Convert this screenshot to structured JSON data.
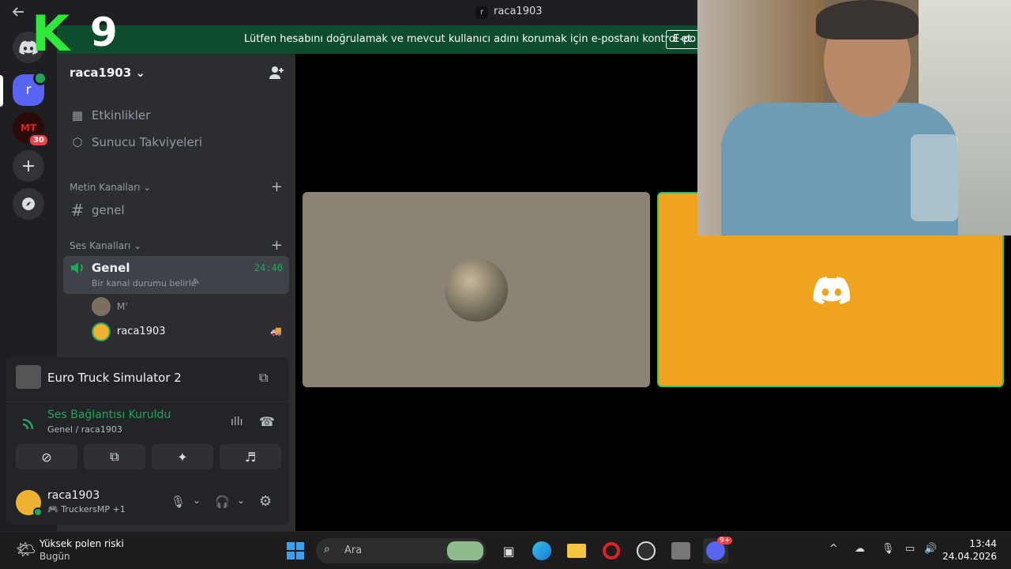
{
  "window": {
    "title": "raca1903",
    "title_icon_letter": "r"
  },
  "banner": {
    "message": "Lütfen hesabını doğrulamak ve mevcut kullanıcı adını korumak için e-postanı kontrol et.",
    "button": "E-po"
  },
  "overlay_logo": {
    "letter": "K",
    "number": "9"
  },
  "rail": {
    "selected_server_letter": "r",
    "mt_badge": "30"
  },
  "sidebar": {
    "server_name": "raca1903",
    "items": [
      {
        "label": "Etkinlikler",
        "icon": "calendar-icon"
      },
      {
        "label": "Sunucu Takviyeleri",
        "icon": "boost-icon"
      }
    ],
    "text_category": "Metin Kanalları",
    "text_channel": "genel",
    "voice_category": "Ses Kanalları",
    "voice_channel": {
      "name": "Genel",
      "timer": "24:40",
      "status": "Bir kanal durumu belirle"
    },
    "voice_users": [
      "M'",
      "raca1903"
    ]
  },
  "panel": {
    "activity": "Euro Truck Simulator 2",
    "connection_status": "Ses Bağlantısı Kuruldu",
    "connection_sub": "Genel / raca1903",
    "user_name": "raca1903",
    "user_status": "TruckersMP",
    "user_status_extra": "+1",
    "colors": {
      "connected": "#23a55a"
    }
  },
  "taskbar": {
    "weather_title": "Yüksek polen riski",
    "weather_sub": "Bugün",
    "search_placeholder": "Ara",
    "discord_badge": "9+",
    "time": "13:44",
    "date": "24.04.2026"
  }
}
